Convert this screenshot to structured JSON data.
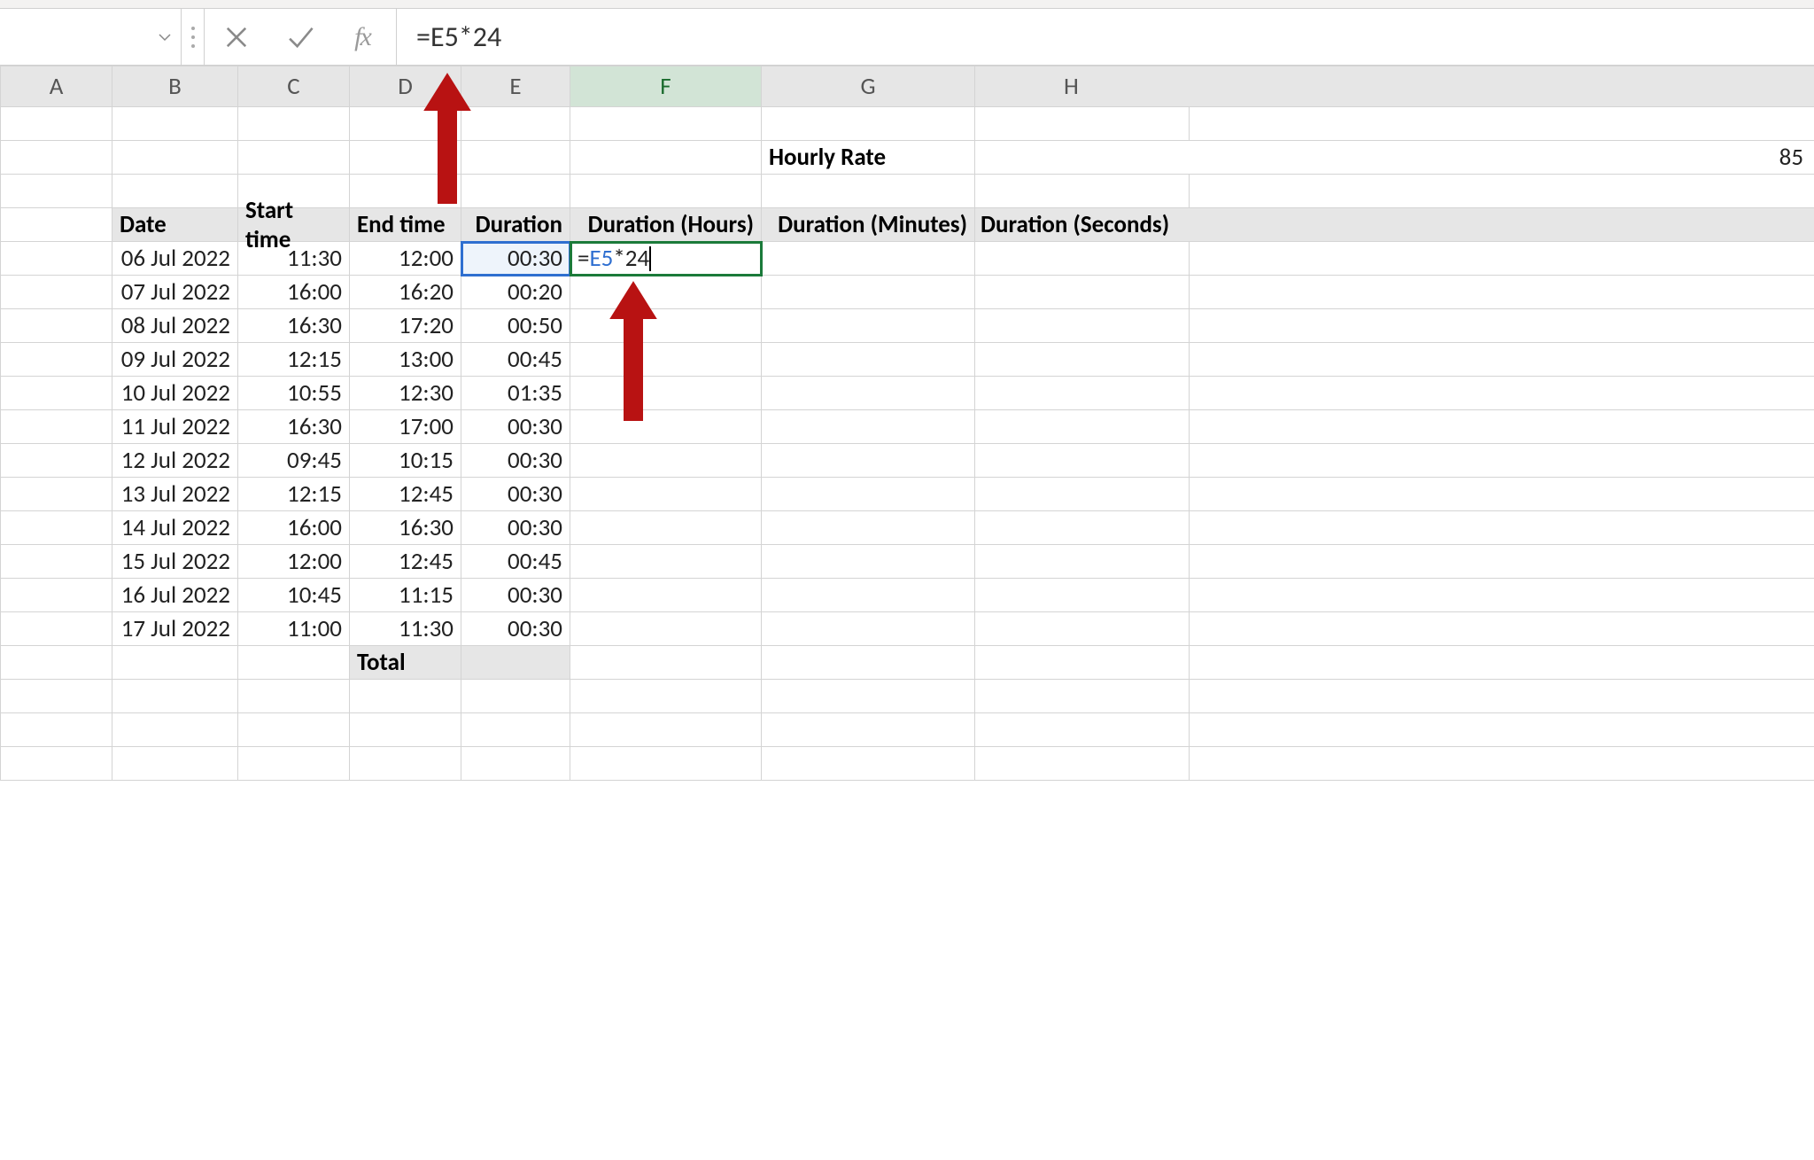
{
  "formula_bar": {
    "formula": "=E5*24",
    "name_box": "",
    "fx_label": "fx"
  },
  "columns": [
    "A",
    "B",
    "C",
    "D",
    "E",
    "F",
    "G",
    "H"
  ],
  "active_col": "F",
  "labels": {
    "hourly_rate": "Hourly Rate",
    "date": "Date",
    "start_time": "Start time",
    "end_time": "End time",
    "duration": "Duration",
    "duration_hours": "Duration (Hours)",
    "duration_minutes": "Duration (Minutes)",
    "duration_seconds": "Duration (Seconds)",
    "total": "Total"
  },
  "hourly_rate_value": "85",
  "active_cell_edit": {
    "prefix": "=",
    "ref": "E5",
    "suffix": "*24"
  },
  "rows": [
    {
      "date": "06 Jul 2022",
      "start": "11:30",
      "end": "12:00",
      "dur": "00:30"
    },
    {
      "date": "07 Jul 2022",
      "start": "16:00",
      "end": "16:20",
      "dur": "00:20"
    },
    {
      "date": "08 Jul 2022",
      "start": "16:30",
      "end": "17:20",
      "dur": "00:50"
    },
    {
      "date": "09 Jul 2022",
      "start": "12:15",
      "end": "13:00",
      "dur": "00:45"
    },
    {
      "date": "10 Jul 2022",
      "start": "10:55",
      "end": "12:30",
      "dur": "01:35"
    },
    {
      "date": "11 Jul 2022",
      "start": "16:30",
      "end": "17:00",
      "dur": "00:30"
    },
    {
      "date": "12 Jul 2022",
      "start": "09:45",
      "end": "10:15",
      "dur": "00:30"
    },
    {
      "date": "13 Jul 2022",
      "start": "12:15",
      "end": "12:45",
      "dur": "00:30"
    },
    {
      "date": "14 Jul 2022",
      "start": "16:00",
      "end": "16:30",
      "dur": "00:30"
    },
    {
      "date": "15 Jul 2022",
      "start": "12:00",
      "end": "12:45",
      "dur": "00:45"
    },
    {
      "date": "16 Jul 2022",
      "start": "10:45",
      "end": "11:15",
      "dur": "00:30"
    },
    {
      "date": "17 Jul 2022",
      "start": "11:00",
      "end": "11:30",
      "dur": "00:30"
    }
  ]
}
